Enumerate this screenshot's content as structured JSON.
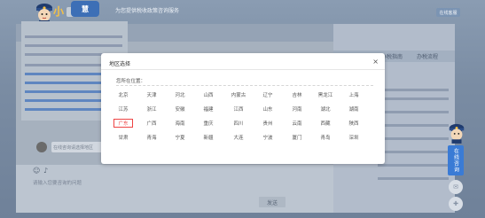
{
  "header": {
    "top_right_button": "在线客服",
    "chat_title": "为您提供税收政策咨询服务",
    "logo_char": "小",
    "logo_badge": "慧"
  },
  "side_tabs": [
    "办税指南",
    "办税流程"
  ],
  "input": {
    "placeholder": "请输入您要咨询的问题",
    "send_label": "发送"
  },
  "asker_preview": "在线咨询请选择地区",
  "float": {
    "online_button": "在线咨询"
  },
  "icons": {
    "location": "location-pin-icon",
    "close": "close-icon",
    "emoji": "emoji-icon",
    "mic": "microphone-icon",
    "qr": "qr-code-icon",
    "user_add": "user-add-icon",
    "chat": "chat-bubble-icon"
  },
  "modal": {
    "title": "地区选择",
    "close": "×",
    "subtitle": "您所在位置：",
    "selected": "广东",
    "rows": [
      [
        "北京",
        "天津",
        "河北",
        "山西",
        "内蒙古",
        "辽宁",
        "吉林",
        "黑龙江",
        "上海"
      ],
      [
        "江苏",
        "浙江",
        "安徽",
        "福建",
        "江西",
        "山东",
        "河南",
        "湖北",
        "湖南"
      ],
      [
        "广东",
        "广西",
        "海南",
        "重庆",
        "四川",
        "贵州",
        "云南",
        "西藏",
        "陕西"
      ],
      [
        "甘肃",
        "青海",
        "宁夏",
        "新疆",
        "大连",
        "宁波",
        "厦门",
        "青岛",
        "深圳"
      ]
    ]
  },
  "colors": {
    "accent": "#3a7bd5",
    "selected": "#e44444"
  }
}
